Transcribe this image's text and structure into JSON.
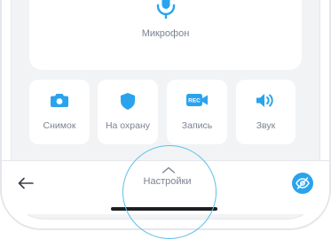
{
  "mic": {
    "label": "Микрофон",
    "icon": "microphone-icon"
  },
  "actions": [
    {
      "label": "Снимок",
      "icon": "camera-icon"
    },
    {
      "label": "На охрану",
      "icon": "shield-icon"
    },
    {
      "label": "Запись",
      "icon": "record-icon",
      "badge": "REC"
    },
    {
      "label": "Звук",
      "icon": "speaker-icon"
    }
  ],
  "bottom": {
    "back_icon": "back-arrow-icon",
    "settings_label": "Настройки",
    "chevron_icon": "chevron-up-icon",
    "privacy_icon": "eye-off-icon"
  },
  "colors": {
    "accent": "#2aa3ee",
    "screen_bg": "#f1f3f5",
    "text_muted": "#7b8290"
  }
}
